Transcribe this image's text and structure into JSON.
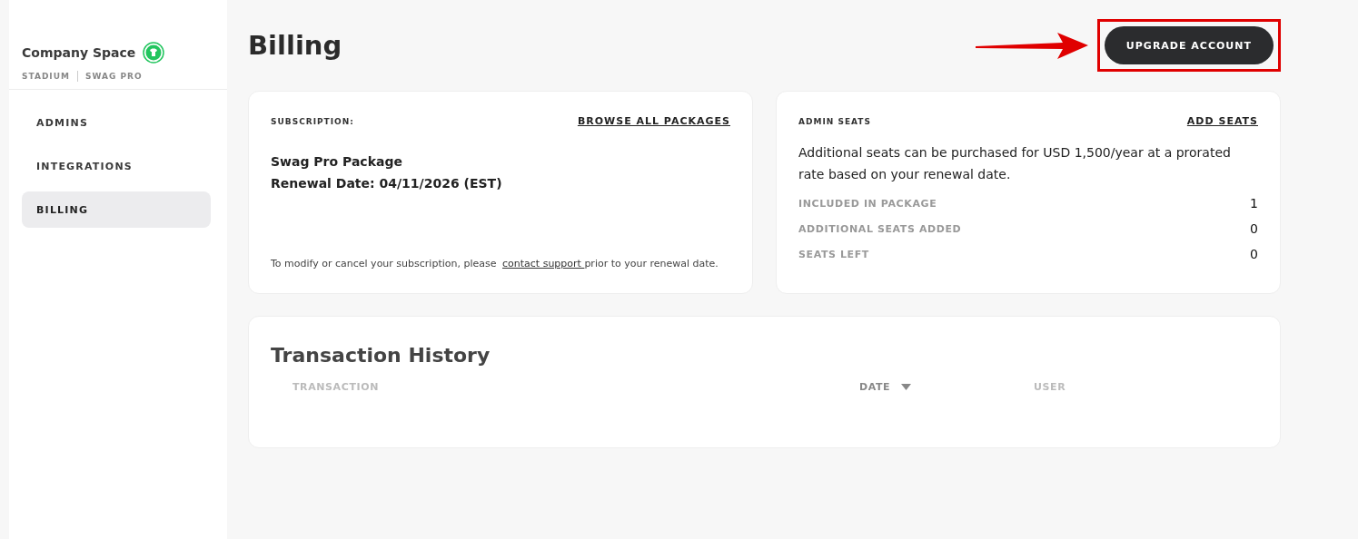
{
  "sidebar": {
    "company": "Company Space",
    "tags": [
      "STADIUM",
      "SWAG PRO"
    ],
    "items": [
      {
        "label": "ADMINS",
        "selected": false
      },
      {
        "label": "INTEGRATIONS",
        "selected": false
      },
      {
        "label": "BILLING",
        "selected": true
      }
    ]
  },
  "page_title": "Billing",
  "upgrade_button": "UPGRADE ACCOUNT",
  "subscription": {
    "heading": "SUBSCRIPTION:",
    "link": "BROWSE ALL PACKAGES",
    "package": "Swag Pro Package",
    "renewal": "Renewal Date: 04/11/2026 (EST)",
    "note_before": "To modify or cancel your subscription, please ",
    "note_link": "contact support ",
    "note_after": "prior to your renewal date."
  },
  "admin_seats": {
    "heading": "ADMIN SEATS",
    "link": "ADD SEATS",
    "description": "Additional seats can be purchased for USD 1,500/year at a prorated rate based on your renewal date.",
    "rows": [
      {
        "label": "INCLUDED IN PACKAGE",
        "value": "1"
      },
      {
        "label": "ADDITIONAL SEATS ADDED",
        "value": "0"
      },
      {
        "label": "SEATS LEFT",
        "value": "0"
      }
    ]
  },
  "transactions": {
    "title": "Transaction History",
    "columns": [
      {
        "label": "TRANSACTION",
        "sorted": false
      },
      {
        "label": "DATE",
        "sorted": true
      },
      {
        "label": "USER",
        "sorted": false
      }
    ]
  }
}
